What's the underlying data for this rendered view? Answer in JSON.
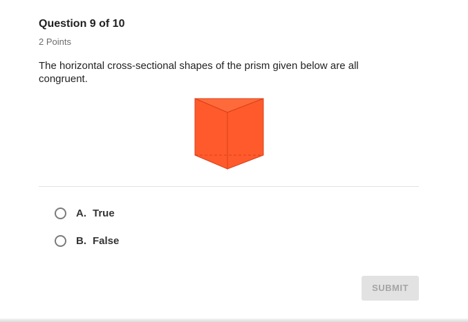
{
  "question": {
    "title": "Question 9 of 10",
    "points": "2 Points",
    "prompt": "The horizontal cross-sectional shapes of the prism given below are all congruent."
  },
  "figure": {
    "shape": "triangular-prism",
    "fill_color": "#ff5a2b",
    "edge_color": "#d8401a"
  },
  "options": [
    {
      "letter": "A.",
      "text": "True"
    },
    {
      "letter": "B.",
      "text": "False"
    }
  ],
  "submit": {
    "label": "SUBMIT",
    "enabled": false
  }
}
